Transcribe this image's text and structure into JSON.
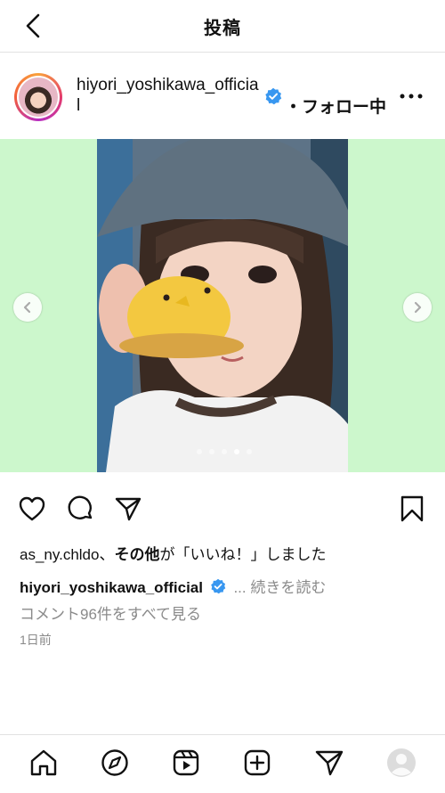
{
  "header": {
    "title": "投稿"
  },
  "post": {
    "username": "hiyori_yoshikawa_official",
    "follow_status": "・フォロー中",
    "carousel": {
      "total": 5,
      "active_index": 3
    },
    "likes_text_user": "as_ny.chldo",
    "likes_text_rest": "、",
    "likes_text_others": "その他",
    "likes_text_end": "が「いいね！」しました",
    "caption_user": "hiyori_yoshikawa_official",
    "caption_more": "... 続きを読む",
    "comments_link": "コメント96件をすべて見る",
    "time_ago": "1日前"
  },
  "icons": {
    "back": "chevron-left-icon",
    "verified": "verified-badge-icon",
    "more": "more-horizontal-icon",
    "like": "heart-icon",
    "comment": "comment-bubble-icon",
    "share": "paper-plane-icon",
    "save": "bookmark-icon",
    "tabs": [
      "home-icon",
      "explore-compass-icon",
      "reels-icon",
      "create-plus-icon",
      "direct-message-icon",
      "profile-avatar-icon"
    ]
  },
  "colors": {
    "media_background": "#ccf7cc",
    "verified": "#3897f0",
    "secondary_text": "#8a8a8a"
  }
}
